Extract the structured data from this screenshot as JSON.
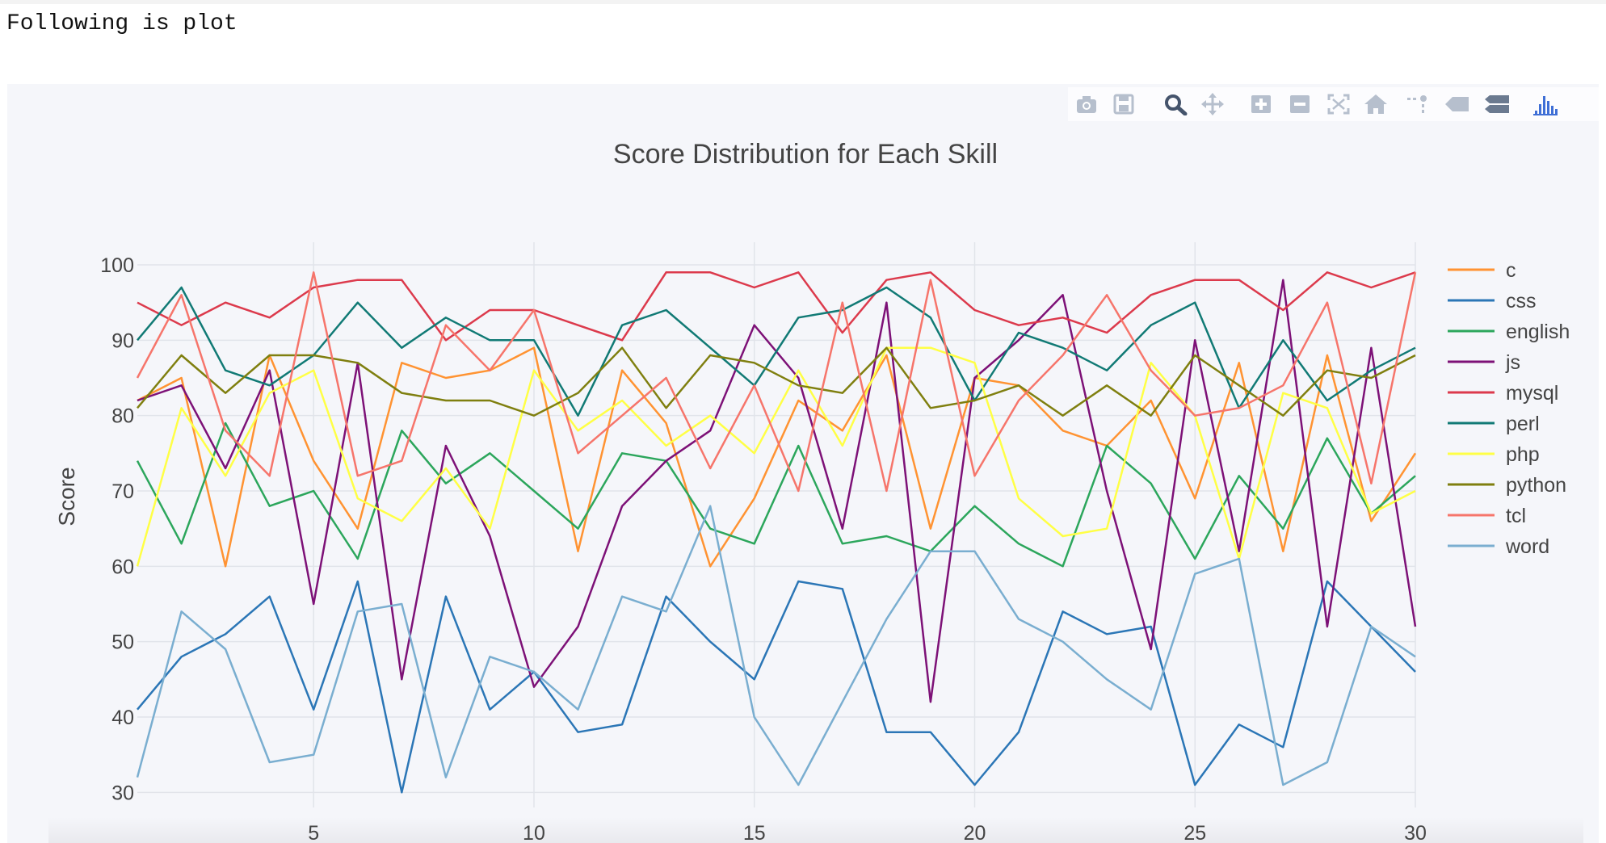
{
  "caption": "Following is plot",
  "modebar": {
    "buttons": [
      {
        "name": "camera-icon",
        "label": "Download plot as a png",
        "color": "#b6bfcd"
      },
      {
        "name": "save-icon",
        "label": "Save",
        "color": "#b6bfcd"
      },
      {
        "name": "zoom-icon",
        "label": "Zoom",
        "color": "#45546c"
      },
      {
        "name": "pan-icon",
        "label": "Pan",
        "color": "#b6bfcd"
      },
      {
        "name": "zoom-in-icon",
        "label": "Zoom in",
        "color": "#b6bfcd"
      },
      {
        "name": "zoom-out-icon",
        "label": "Zoom out",
        "color": "#b6bfcd"
      },
      {
        "name": "autoscale-icon",
        "label": "Autoscale",
        "color": "#b6bfcd"
      },
      {
        "name": "home-icon",
        "label": "Reset axes",
        "color": "#b6bfcd"
      },
      {
        "name": "spikelines-icon",
        "label": "Toggle spike lines",
        "color": "#b6bfcd"
      },
      {
        "name": "hover-closest-icon",
        "label": "Show closest data on hover",
        "color": "#b6bfcd"
      },
      {
        "name": "hover-compare-icon",
        "label": "Compare data on hover",
        "color": "#6b7a90"
      },
      {
        "name": "plotly-logo-icon",
        "label": "Produced with Plotly",
        "color": "#3f6fd6"
      }
    ]
  },
  "chart_data": {
    "type": "line",
    "title": "Score Distribution for Each Skill",
    "xlabel": "",
    "ylabel": "Score",
    "xlim": [
      1,
      30
    ],
    "ylim": [
      28,
      103
    ],
    "xticks": [
      5,
      10,
      15,
      20,
      25,
      30
    ],
    "yticks": [
      30,
      40,
      50,
      60,
      70,
      80,
      90,
      100
    ],
    "grid": true,
    "legend_position": "right",
    "x": [
      1,
      2,
      3,
      4,
      5,
      6,
      7,
      8,
      9,
      10,
      11,
      12,
      13,
      14,
      15,
      16,
      17,
      18,
      19,
      20,
      21,
      22,
      23,
      24,
      25,
      26,
      27,
      28,
      29,
      30
    ],
    "series": [
      {
        "name": "c",
        "color": "#ff9332",
        "values": [
          82,
          85,
          60,
          88,
          74,
          65,
          87,
          85,
          86,
          89,
          62,
          86,
          79,
          60,
          69,
          82,
          78,
          88,
          65,
          85,
          84,
          78,
          76,
          82,
          69,
          87,
          62,
          88,
          66,
          75
        ]
      },
      {
        "name": "css",
        "color": "#2b76b6",
        "values": [
          41,
          48,
          51,
          56,
          41,
          58,
          30,
          56,
          41,
          46,
          38,
          39,
          56,
          50,
          45,
          58,
          57,
          38,
          38,
          31,
          38,
          54,
          51,
          52,
          31,
          39,
          36,
          58,
          52,
          46
        ]
      },
      {
        "name": "english",
        "color": "#2ca65c",
        "values": [
          74,
          63,
          79,
          68,
          70,
          61,
          78,
          71,
          75,
          70,
          65,
          75,
          74,
          65,
          63,
          76,
          63,
          64,
          62,
          68,
          63,
          60,
          76,
          71,
          61,
          72,
          65,
          77,
          67,
          72
        ]
      },
      {
        "name": "js",
        "color": "#7d1177",
        "values": [
          82,
          84,
          73,
          86,
          55,
          87,
          45,
          76,
          64,
          44,
          52,
          68,
          74,
          78,
          92,
          85,
          65,
          95,
          42,
          85,
          90,
          96,
          70,
          49,
          90,
          62,
          98,
          52,
          89,
          52
        ]
      },
      {
        "name": "mysql",
        "color": "#dc3a4c",
        "values": [
          95,
          92,
          95,
          93,
          97,
          98,
          98,
          90,
          94,
          94,
          92,
          90,
          99,
          99,
          97,
          99,
          91,
          98,
          99,
          94,
          92,
          93,
          91,
          96,
          98,
          98,
          94,
          99,
          97,
          99
        ]
      },
      {
        "name": "perl",
        "color": "#117a75",
        "values": [
          90,
          97,
          86,
          84,
          88,
          95,
          89,
          93,
          90,
          90,
          80,
          92,
          94,
          89,
          84,
          93,
          94,
          97,
          93,
          82,
          91,
          89,
          86,
          92,
          95,
          81,
          90,
          82,
          86,
          89
        ]
      },
      {
        "name": "php",
        "color": "#ffff45",
        "values": [
          60,
          81,
          72,
          83,
          86,
          69,
          66,
          73,
          65,
          86,
          78,
          82,
          76,
          80,
          75,
          86,
          76,
          89,
          89,
          87,
          69,
          64,
          65,
          87,
          80,
          61,
          83,
          81,
          67,
          70
        ]
      },
      {
        "name": "python",
        "color": "#7f7f0f",
        "values": [
          81,
          88,
          83,
          88,
          88,
          87,
          83,
          82,
          82,
          80,
          83,
          89,
          81,
          88,
          87,
          84,
          83,
          89,
          81,
          82,
          84,
          80,
          84,
          80,
          88,
          84,
          80,
          86,
          85,
          88
        ]
      },
      {
        "name": "tcl",
        "color": "#f6756b",
        "values": [
          85,
          96,
          78,
          72,
          99,
          72,
          74,
          92,
          86,
          94,
          75,
          80,
          85,
          73,
          84,
          70,
          95,
          70,
          98,
          72,
          82,
          88,
          96,
          86,
          80,
          81,
          84,
          95,
          71,
          99
        ]
      },
      {
        "name": "word",
        "color": "#7aaed0",
        "values": [
          32,
          54,
          49,
          34,
          35,
          54,
          55,
          32,
          48,
          46,
          41,
          56,
          54,
          68,
          40,
          31,
          42,
          53,
          62,
          62,
          53,
          50,
          45,
          41,
          59,
          61,
          31,
          34,
          52,
          48
        ]
      }
    ]
  }
}
